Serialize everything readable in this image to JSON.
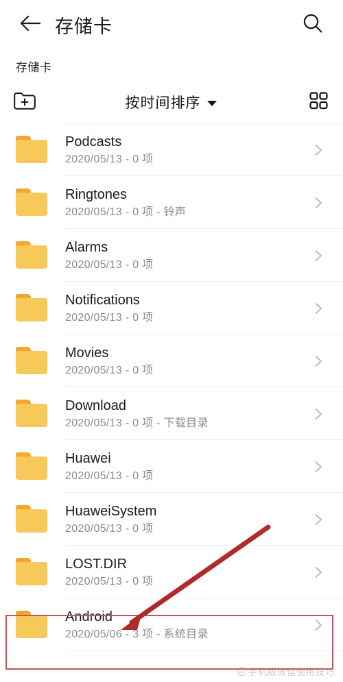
{
  "appbar": {
    "back_icon": "back-arrow-icon",
    "title": "存储卡",
    "search_icon": "search-icon"
  },
  "breadcrumb": {
    "items": [
      {
        "label": "存储卡"
      }
    ]
  },
  "toolbar": {
    "new_folder_icon": "new-folder-icon",
    "sort_label": "按时间排序",
    "sort_caret_icon": "chevron-down-icon",
    "view_grid_icon": "grid-view-icon"
  },
  "list": {
    "chevron_icon": "chevron-right-icon",
    "folder_icon": "folder-icon",
    "rows": [
      {
        "name": "Podcasts",
        "meta": "2020/05/13 - 0 项"
      },
      {
        "name": "Ringtones",
        "meta": "2020/05/13 - 0 项 - 铃声"
      },
      {
        "name": "Alarms",
        "meta": "2020/05/13 - 0 项"
      },
      {
        "name": "Notifications",
        "meta": "2020/05/13 - 0 项"
      },
      {
        "name": "Movies",
        "meta": "2020/05/13 - 0 项"
      },
      {
        "name": "Download",
        "meta": "2020/05/13 - 0 项 - 下载目录"
      },
      {
        "name": "Huawei",
        "meta": "2020/05/13 - 0 项"
      },
      {
        "name": "HuaweiSystem",
        "meta": "2020/05/13 - 0 项"
      },
      {
        "name": "LOST.DIR",
        "meta": "2020/05/13 - 0 项"
      },
      {
        "name": "Android",
        "meta": "2020/05/06 - 3 项 - 系统目录"
      }
    ]
  },
  "annotations": {
    "highlight_color": "#c0555f",
    "arrow_color": "#b02a2a",
    "highlight_target": "Android",
    "watermark_text": "手机版微信使用技巧"
  }
}
